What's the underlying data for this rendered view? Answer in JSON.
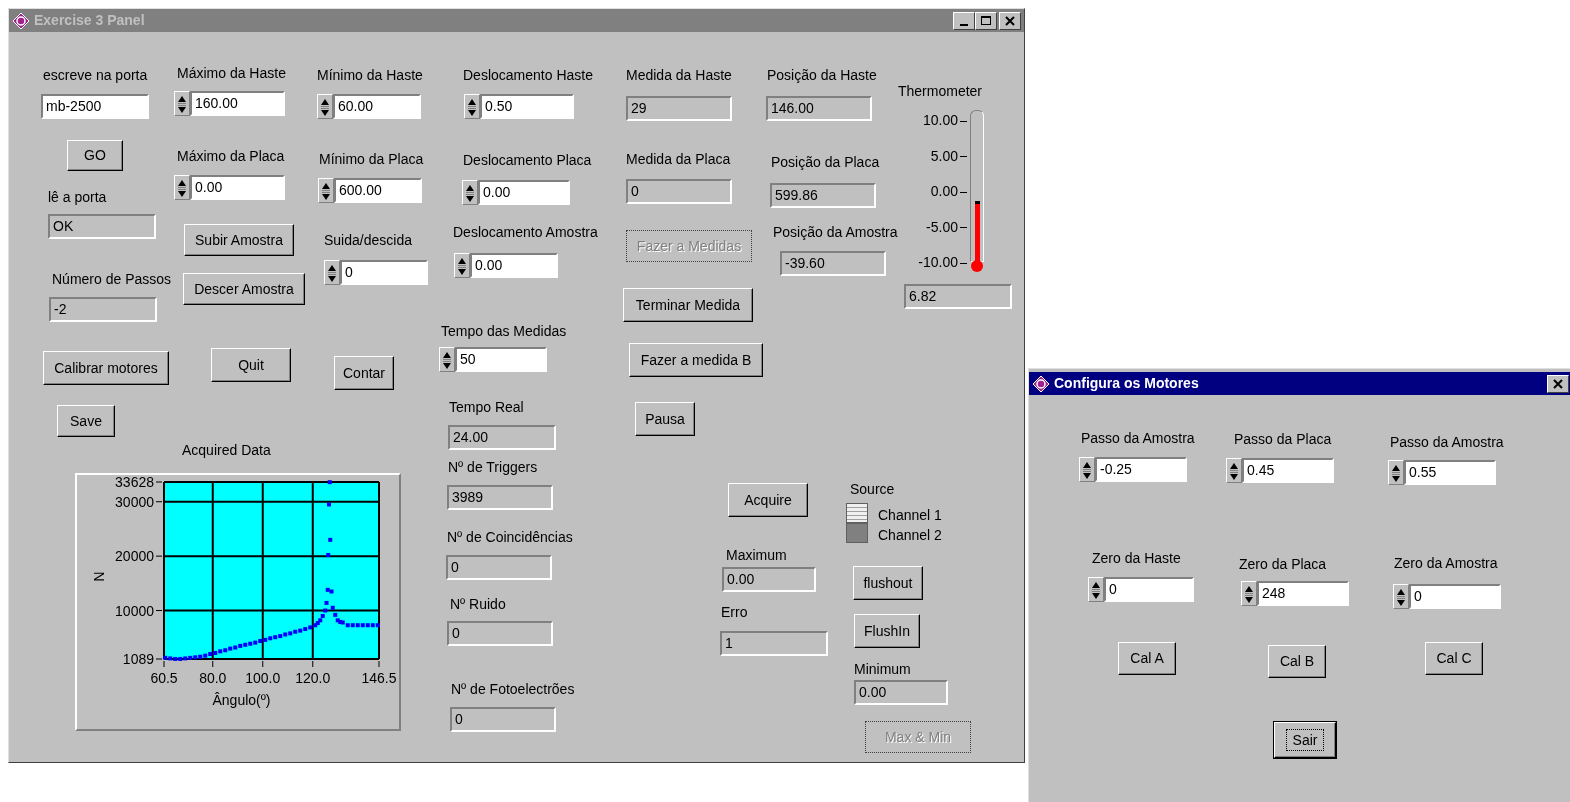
{
  "main_window": {
    "title": "Exercise 3 Panel",
    "controls": [
      {
        "kind": "text",
        "label": "escreve na porta",
        "value": "mb-2500"
      },
      {
        "kind": "numeric",
        "label": "Máximo da Haste",
        "value": "160.00"
      },
      {
        "kind": "numeric",
        "label": "Mínimo da Haste",
        "value": "60.00"
      },
      {
        "kind": "numeric",
        "label": "Deslocamento Haste",
        "value": "0.50"
      },
      {
        "kind": "indicator",
        "label": "Medida da Haste",
        "value": "29"
      },
      {
        "kind": "indicator",
        "label": "Posição da Haste",
        "value": "146.00"
      },
      {
        "kind": "button",
        "label": "GO",
        "disabled": false
      },
      {
        "kind": "numeric",
        "label": "Máximo da Placa",
        "value": "0.00"
      },
      {
        "kind": "numeric",
        "label": "Mínimo da Placa",
        "value": "600.00"
      },
      {
        "kind": "numeric",
        "label": "Deslocamento Placa",
        "value": "0.00"
      },
      {
        "kind": "indicator",
        "label": "Medida da Placa",
        "value": "0"
      },
      {
        "kind": "indicator",
        "label": "Posição da Placa",
        "value": "599.86"
      },
      {
        "kind": "indicator",
        "label": "lê a porta",
        "value": "OK"
      },
      {
        "kind": "button",
        "label": "Subir Amostra",
        "disabled": false
      },
      {
        "kind": "numeric",
        "label": "Suida/descida",
        "value": "0"
      },
      {
        "kind": "numeric",
        "label": "Deslocamento Amostra",
        "value": "0.00"
      },
      {
        "kind": "button",
        "label": "Fazer a Medidas",
        "disabled": true
      },
      {
        "kind": "indicator",
        "label": "Posição da Amostra",
        "value": "-39.60"
      },
      {
        "kind": "indicator",
        "label": "Número de Passos",
        "value": "-2"
      },
      {
        "kind": "button",
        "label": "Descer Amostra",
        "disabled": false
      },
      {
        "kind": "button",
        "label": "Terminar Medida",
        "disabled": false
      },
      {
        "kind": "numeric",
        "label": "Tempo das Medidas",
        "value": "50"
      },
      {
        "kind": "button",
        "label": "Calibrar motores",
        "disabled": false
      },
      {
        "kind": "button",
        "label": "Quit",
        "disabled": false
      },
      {
        "kind": "button",
        "label": "Contar",
        "disabled": false
      },
      {
        "kind": "button",
        "label": "Fazer a medida B",
        "disabled": false
      },
      {
        "kind": "button",
        "label": "Save",
        "disabled": false
      },
      {
        "kind": "indicator",
        "label": "Tempo Real",
        "value": "24.00"
      },
      {
        "kind": "button",
        "label": "Pausa",
        "disabled": false
      },
      {
        "kind": "indicator",
        "label": "Nº de Triggers",
        "value": "3989"
      },
      {
        "kind": "button",
        "label": "Acquire",
        "disabled": false
      },
      {
        "kind": "indicator",
        "label": "Nº de Coincidências",
        "value": "0"
      },
      {
        "kind": "indicator",
        "label": "Maximum",
        "value": "0.00"
      },
      {
        "kind": "button",
        "label": "flushout",
        "disabled": false
      },
      {
        "kind": "indicator",
        "label": "Nº Ruido",
        "value": "0"
      },
      {
        "kind": "indicator",
        "label": "Erro",
        "value": "1"
      },
      {
        "kind": "button",
        "label": "FlushIn",
        "disabled": false
      },
      {
        "kind": "indicator",
        "label": "Minimum",
        "value": "0.00"
      },
      {
        "kind": "indicator",
        "label": "Nº de Fotoelectrões",
        "value": "0"
      },
      {
        "kind": "button",
        "label": "Max & Min",
        "disabled": true
      }
    ],
    "thermometer": {
      "label": "Thermometer",
      "scale": [
        "10.00",
        "5.00",
        "0.00",
        "-5.00",
        "-10.00"
      ],
      "level": 0.4,
      "reading": "6.82"
    },
    "source": {
      "label": "Source",
      "options": [
        {
          "label": "Channel 1",
          "selected": true
        },
        {
          "label": "Channel 2",
          "selected": false
        }
      ]
    },
    "graph": {
      "chart_data": {
        "type": "scatter",
        "title": "Acquired Data",
        "xlabel": "Ângulo(º)",
        "ylabel": "N",
        "x": [
          61,
          63,
          65,
          67,
          69,
          71,
          73,
          75,
          77,
          79,
          81,
          83,
          85,
          87,
          89,
          91,
          93,
          95,
          97,
          99,
          101,
          103,
          105,
          107,
          109,
          111,
          113,
          115,
          117,
          119,
          121,
          122,
          123,
          124,
          125,
          125.5,
          126,
          126.2,
          126.5,
          126.8,
          127,
          127.5,
          128,
          129,
          130,
          131,
          132,
          134,
          136,
          138,
          140,
          142,
          144,
          146
        ],
        "series": [
          {
            "color": "#0000ff",
            "values": [
              1300,
              1200,
              1100,
              1100,
              1200,
              1300,
              1400,
              1500,
              1700,
              2000,
              2200,
              2500,
              2700,
              3000,
              3200,
              3500,
              3700,
              3900,
              4100,
              4400,
              4600,
              4900,
              5100,
              5300,
              5600,
              5800,
              6100,
              6300,
              6600,
              6900,
              7300,
              7700,
              8200,
              9000,
              10000,
              11400,
              13800,
              20200,
              29500,
              33600,
              23000,
              13500,
              10500,
              9200,
              8200,
              7900,
              7800,
              7300,
              7300,
              7300,
              7300,
              7300,
              7300,
              7300
            ]
          }
        ],
        "xlim": [
          60.5,
          146.5
        ],
        "ylim": [
          1089,
          33628
        ],
        "xticks": [
          60.5,
          {
            "value": 80,
            "label": "80.0"
          },
          {
            "value": 100,
            "label": "100.0"
          },
          {
            "value": 120,
            "label": "120.0"
          },
          146.5
        ],
        "grid": true,
        "yticks": [
          1089,
          10000,
          20000,
          30000,
          33628
        ]
      }
    }
  },
  "dialog": {
    "title": "Configura os Motores",
    "controls": [
      {
        "kind": "numeric",
        "label": "Passo da Amostra",
        "value": "-0.25"
      },
      {
        "kind": "numeric",
        "label": "Passo da Placa",
        "value": "0.45"
      },
      {
        "kind": "numeric",
        "label": "Passo da Amostra",
        "value": "0.55"
      },
      {
        "kind": "numeric",
        "label": "Zero da Haste",
        "value": "0"
      },
      {
        "kind": "numeric",
        "label": "Zero da Placa",
        "value": "248"
      },
      {
        "kind": "numeric",
        "label": "Zero da Amostra",
        "value": "0"
      },
      {
        "kind": "button",
        "label": "Cal A",
        "focused": false
      },
      {
        "kind": "button",
        "label": "Cal B",
        "focused": false
      },
      {
        "kind": "button",
        "label": "Cal C",
        "focused": false
      },
      {
        "kind": "button",
        "label": "Sair",
        "focused": true
      }
    ]
  }
}
